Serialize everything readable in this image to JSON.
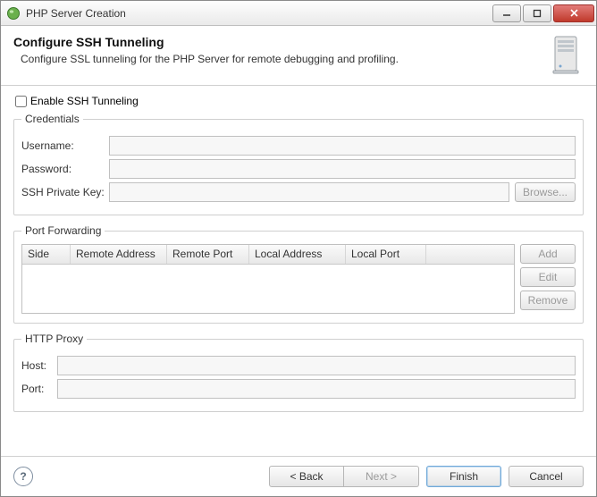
{
  "window": {
    "title": "PHP Server Creation"
  },
  "banner": {
    "title": "Configure SSH Tunneling",
    "description": "Configure SSL tunneling for the PHP Server for remote debugging and profiling."
  },
  "enable_checkbox_label": "Enable SSH Tunneling",
  "credentials": {
    "legend": "Credentials",
    "username_label": "Username:",
    "username_value": "",
    "password_label": "Password:",
    "password_value": "",
    "ssh_key_label": "SSH Private Key:",
    "ssh_key_value": "",
    "browse_label": "Browse..."
  },
  "port_forwarding": {
    "legend": "Port Forwarding",
    "columns": {
      "side": "Side",
      "remote_address": "Remote Address",
      "remote_port": "Remote Port",
      "local_address": "Local Address",
      "local_port": "Local Port"
    },
    "rows": [],
    "buttons": {
      "add": "Add",
      "edit": "Edit",
      "remove": "Remove"
    }
  },
  "http_proxy": {
    "legend": "HTTP Proxy",
    "host_label": "Host:",
    "host_value": "",
    "port_label": "Port:",
    "port_value": ""
  },
  "footer": {
    "back": "< Back",
    "next": "Next >",
    "finish": "Finish",
    "cancel": "Cancel"
  }
}
